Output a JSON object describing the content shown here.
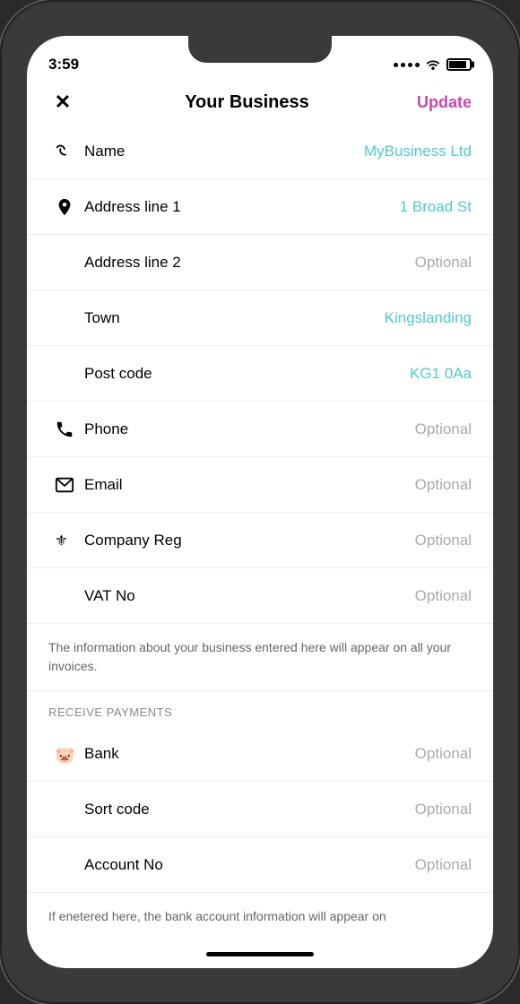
{
  "status_bar": {
    "time": "3:59"
  },
  "nav": {
    "close_label": "✕",
    "title": "Your Business",
    "update_label": "Update"
  },
  "form": {
    "rows": [
      {
        "id": "name",
        "icon": "name",
        "label": "Name",
        "value": "MyBusiness Ltd",
        "optional": false
      },
      {
        "id": "address1",
        "icon": "location",
        "label": "Address line 1",
        "value": "1 Broad St",
        "optional": false
      },
      {
        "id": "address2",
        "icon": null,
        "label": "Address line 2",
        "value": "Optional",
        "optional": true
      },
      {
        "id": "town",
        "icon": null,
        "label": "Town",
        "value": "Kingslanding",
        "optional": false
      },
      {
        "id": "postcode",
        "icon": null,
        "label": "Post code",
        "value": "KG1 0Aa",
        "optional": false
      },
      {
        "id": "phone",
        "icon": "phone",
        "label": "Phone",
        "value": "Optional",
        "optional": true
      },
      {
        "id": "email",
        "icon": "email",
        "label": "Email",
        "value": "Optional",
        "optional": true
      },
      {
        "id": "company_reg",
        "icon": "crest",
        "label": "Company Reg",
        "value": "Optional",
        "optional": true
      },
      {
        "id": "vat",
        "icon": null,
        "label": "VAT No",
        "value": "Optional",
        "optional": true
      }
    ],
    "info_text": "The information about your business entered here will appear on all your invoices.",
    "receive_payments_header": "Receive payments",
    "payment_rows": [
      {
        "id": "bank",
        "icon": "bank",
        "label": "Bank",
        "value": "Optional",
        "optional": true
      },
      {
        "id": "sort_code",
        "icon": null,
        "label": "Sort code",
        "value": "Optional",
        "optional": true
      },
      {
        "id": "account_no",
        "icon": null,
        "label": "Account No",
        "value": "Optional",
        "optional": true
      }
    ],
    "bottom_text": "If enetered here, the bank account information will appear on"
  },
  "colors": {
    "accent": "#c847b0",
    "teal": "#4ecdc4",
    "optional_gray": "#aaaaaa"
  }
}
